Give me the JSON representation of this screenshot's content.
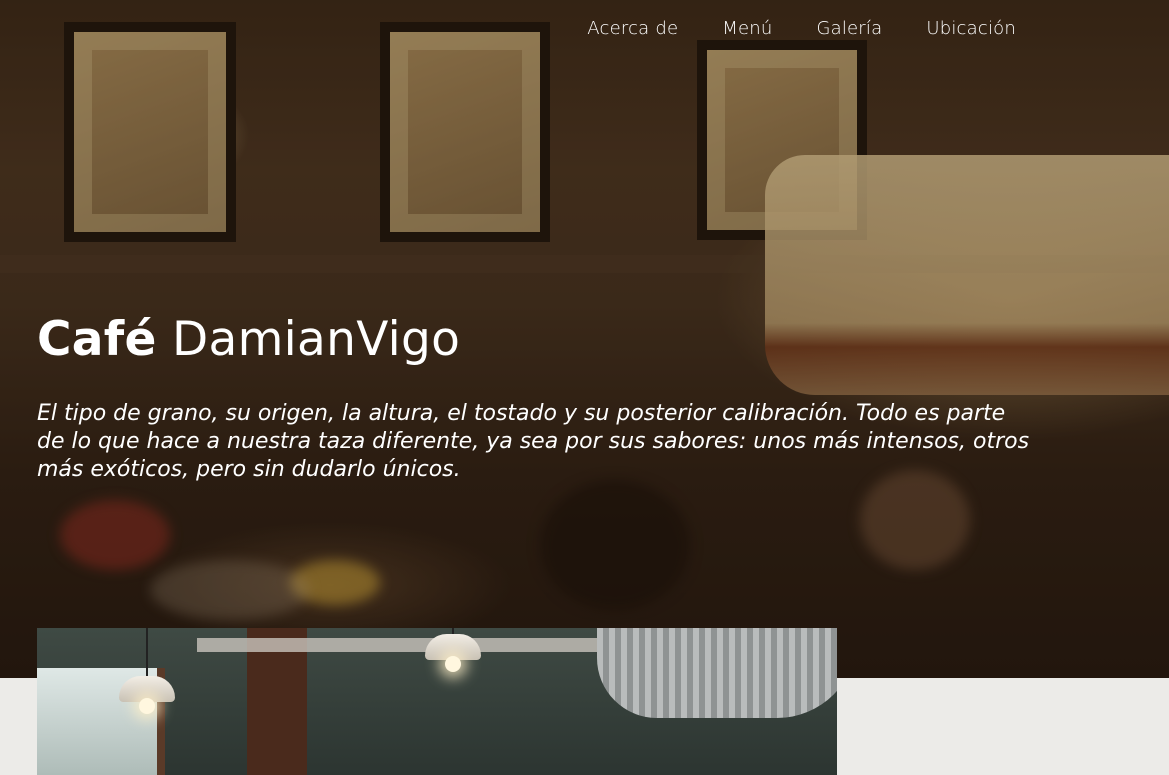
{
  "nav": {
    "items": [
      "Acerca de",
      "Menú",
      "Galería",
      "Ubicación"
    ]
  },
  "hero": {
    "title_bold": "Café",
    "title_light": "DamianVigo",
    "tagline": "El tipo de grano, su origen, la altura, el tostado y su posterior calibración. Todo es parte de lo que hace a nuestra taza diferente, ya sea por sus sabores: unos más intensos, otros más exóticos, pero sin dudarlo únicos."
  },
  "colors": {
    "text": "#ffffff",
    "page_background": "#ecebe8",
    "hero_dark": "#2e1f14"
  }
}
